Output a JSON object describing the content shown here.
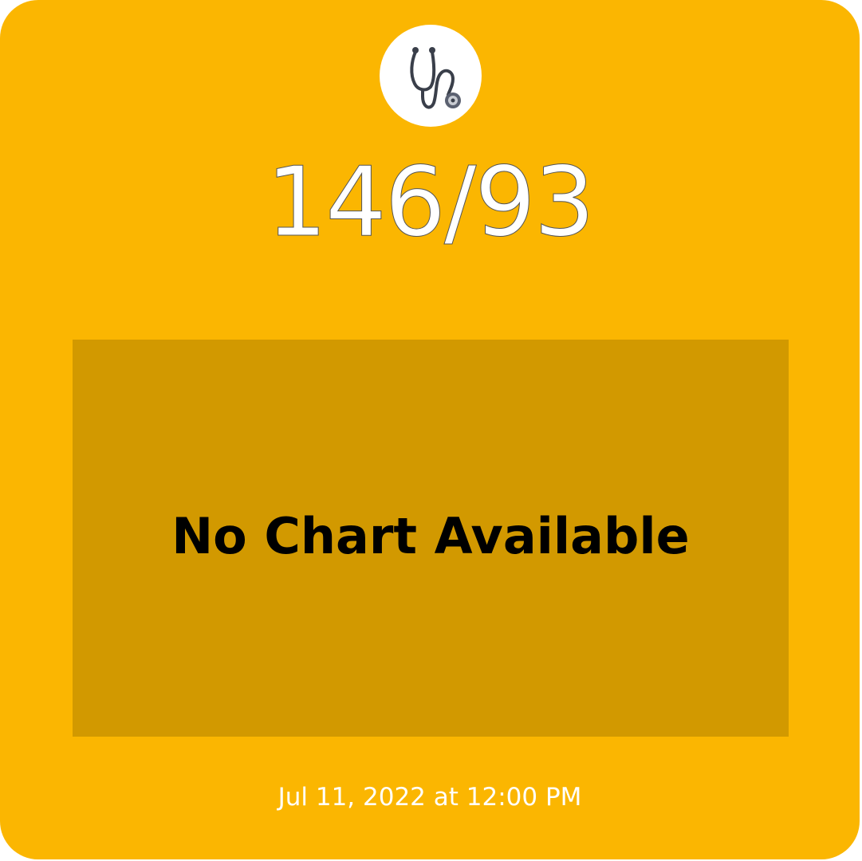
{
  "card": {
    "background_color": "#FBB601",
    "icon": "stethoscope-icon",
    "reading": "146/93"
  },
  "chart": {
    "background_color": "#D29900",
    "message": "No Chart Available"
  },
  "footer": {
    "timestamp": "Jul 11, 2022 at 12:00 PM"
  }
}
